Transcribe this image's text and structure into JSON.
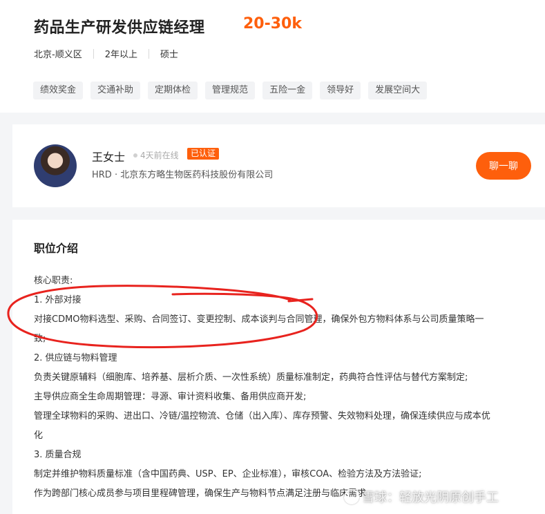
{
  "job": {
    "title": "药品生产研发供应链经理",
    "salary": "20-30k",
    "location": "北京-顺义区",
    "experience": "2年以上",
    "education": "硕士",
    "tags": [
      "绩效奖金",
      "交通补助",
      "定期体检",
      "管理规范",
      "五险一金",
      "领导好",
      "发展空间大"
    ]
  },
  "recruiter": {
    "name": "王女士",
    "online_status": "4天前在线",
    "verified_label": "已认证",
    "company_line": "HRD · 北京东方略生物医药科技股份有限公司",
    "chat_label": "聊一聊"
  },
  "description": {
    "title": "职位介绍",
    "lines": [
      "核心职责:",
      "1. 外部对接",
      "对接CDMO物料选型、采购、合同签订、变更控制、成本谈判与合同管理，确保外包方物料体系与公司质量策略一",
      "致;",
      "2. 供应链与物料管理",
      "负责关键原辅料（细胞库、培养基、层析介质、一次性系统）质量标准制定，药典符合性评估与替代方案制定;",
      "主导供应商全生命周期管理：寻源、审计资料收集、备用供应商开发;",
      "管理全球物料的采购、进出口、冷链/温控物流、仓储（出入库）、库存预警、失效物料处理，确保连续供应与成本优",
      "化",
      "3. 质量合规",
      "制定并维护物料质量标准（含中国药典、USP、EP、企业标准），审核COA、检验方法及方法验证;",
      "作为跨部门核心成员参与项目里程碑管理，确保生产与物料节点满足注册与临床需求"
    ]
  },
  "watermark": {
    "text": "雪球：轻放光阴原创手工"
  },
  "colors": {
    "accent": "#fe5f0c",
    "annotation": "#e8231e"
  }
}
